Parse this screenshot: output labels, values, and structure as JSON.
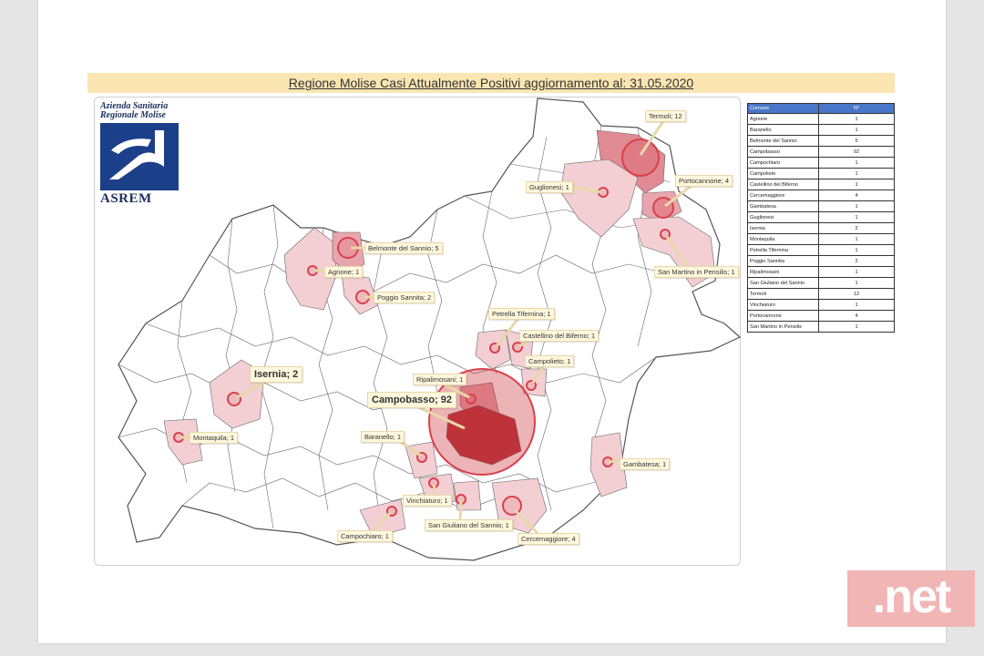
{
  "title": "Regione Molise Casi Attualmente Positivi aggiornamento al: 31.05.2020",
  "logo": {
    "line1": "Azienda Sanitaria",
    "line2": "Regionale Molise",
    "name": "ASREM"
  },
  "table": {
    "headers": [
      "Comune",
      "N°"
    ],
    "rows": [
      [
        "Agnone",
        "1"
      ],
      [
        "Baranello",
        "1"
      ],
      [
        "Belmonte del Sannio",
        "5"
      ],
      [
        "Campobasso",
        "92"
      ],
      [
        "Campochiaro",
        "1"
      ],
      [
        "Campolieto",
        "1"
      ],
      [
        "Castellino del Biferno",
        "1"
      ],
      [
        "Cercemaggiore",
        "4"
      ],
      [
        "Gambatesa",
        "1"
      ],
      [
        "Guglionesi",
        "1"
      ],
      [
        "Isernia",
        "2"
      ],
      [
        "Montaquila",
        "1"
      ],
      [
        "Petrella Tifernina",
        "1"
      ],
      [
        "Poggio Sannita",
        "2"
      ],
      [
        "Ripalimosani",
        "1"
      ],
      [
        "San Giuliano del Sannio",
        "1"
      ],
      [
        "Termoli",
        "12"
      ],
      [
        "Vinchiaturo",
        "1"
      ],
      [
        "Portocannone",
        "4"
      ],
      [
        "San Martino in Pensilis",
        "1"
      ]
    ]
  },
  "callouts": {
    "termoli": "Termoli; 12",
    "portocannone": "Portocannone; 4",
    "guglionesi": "Guglionesi; 1",
    "san_martino": "San Martino in Pensilis; 1",
    "belmonte": "Belmonte del Sannio; 5",
    "agnone": "Agnone; 1",
    "poggio": "Poggio Sannita; 2",
    "petrella": "Petrella Tifernina; 1",
    "castellino": "Castellino del Biferno; 1",
    "campolieto": "Campolieto; 1",
    "ripalimosani": "Ripalimosani; 1",
    "campobasso": "Campobasso; 92",
    "isernia": "Isernia; 2",
    "montaquila": "Montaquila; 1",
    "baranello": "Baranello; 1",
    "vinchiaturo": "Vinchiaturo; 1",
    "campochiaro": "Campochiaro; 1",
    "san_giuliano": "San Giuliano del Sannio; 1",
    "cercemaggiore": "Cercemaggiore; 4",
    "gambatesa": "Gambatesa; 1"
  },
  "colors": {
    "title_bg": "#fbe6b3",
    "highlight_fill": "#f3cfd3",
    "campobasso_fill": "#b83a3e",
    "circle": "#d9404a",
    "table_header": "#4a76c9"
  },
  "watermark": ".net"
}
